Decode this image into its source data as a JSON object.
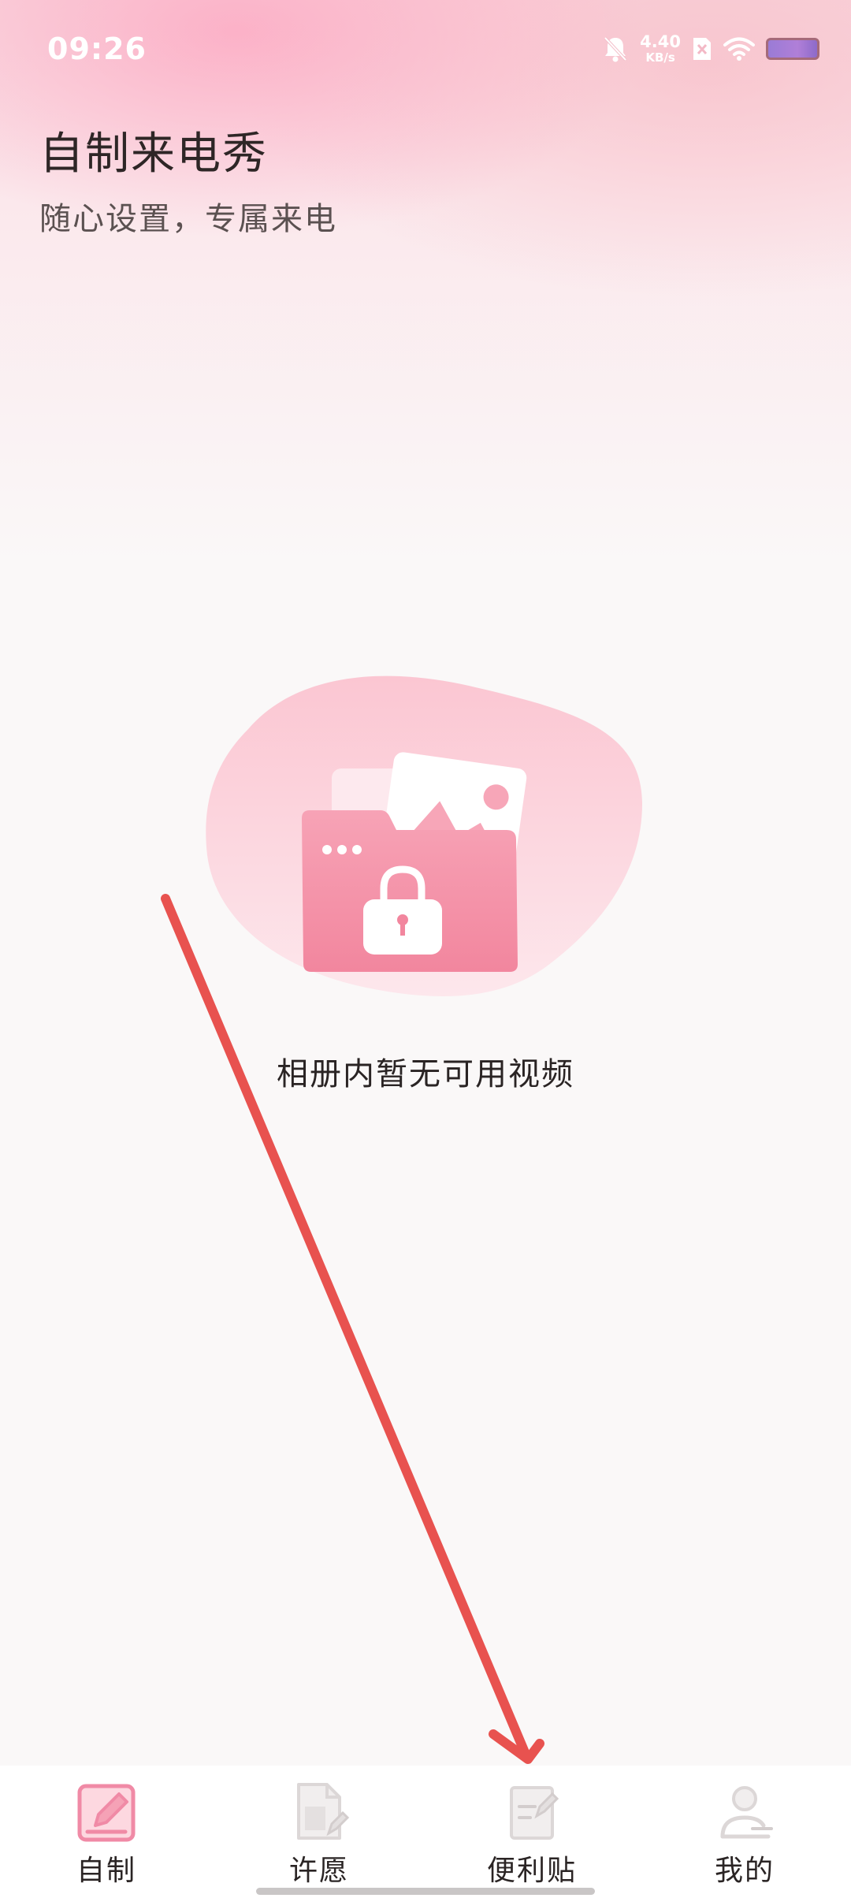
{
  "status_bar": {
    "time": "09:26",
    "network_speed_value": "4.40",
    "network_speed_unit": "KB/s"
  },
  "header": {
    "title": "自制来电秀",
    "subtitle": "随心设置，专属来电"
  },
  "empty_state": {
    "message": "相册内暂无可用视频"
  },
  "bottom_nav": {
    "items": [
      {
        "label": "自制",
        "icon": "pencil-edit-icon",
        "active": true
      },
      {
        "label": "许愿",
        "icon": "wish-document-icon",
        "active": false
      },
      {
        "label": "便利贴",
        "icon": "sticky-note-icon",
        "active": false
      },
      {
        "label": "我的",
        "icon": "profile-icon",
        "active": false
      }
    ]
  },
  "colors": {
    "accent": "#f08aa6",
    "annotation_red": "#e8524f",
    "inactive_icon": "#d9d4d4"
  }
}
